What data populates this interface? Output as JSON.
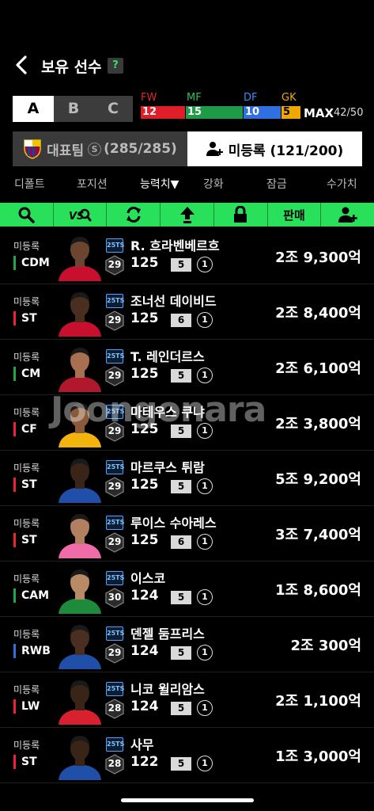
{
  "header": {
    "title": "보유 선수",
    "help_label": "?"
  },
  "abc_tabs": [
    {
      "label": "A",
      "active": true
    },
    {
      "label": "B",
      "active": false
    },
    {
      "label": "C",
      "active": false
    }
  ],
  "position_bars": {
    "items": [
      {
        "label": "FW",
        "count": "12",
        "color": "#e01e2a",
        "label_color": "#e0262f"
      },
      {
        "label": "MF",
        "count": "15",
        "color": "#1f9a46",
        "label_color": "#2fc25a"
      },
      {
        "label": "DF",
        "count": "10",
        "color": "#2f6fe0",
        "label_color": "#3a8cff"
      },
      {
        "label": "GK",
        "count": "5",
        "color": "#f0a800",
        "label_color": "#f0a800"
      }
    ],
    "max_label": "MAX",
    "max_count": "42/50"
  },
  "team_tabs": {
    "national": {
      "label": "대표팀",
      "count": "(285/285)",
      "s_badge": "S"
    },
    "unregistered": {
      "label": "미등록 (121/200)"
    }
  },
  "sort_options": [
    "디폴트",
    "포지션",
    "능력치",
    "강화",
    "잠금",
    "수가치"
  ],
  "sort_active": "능력치",
  "sort_arrow": "▼",
  "toolbar": {
    "sell_label": "판매",
    "icons": [
      "search-icon",
      "vs-compare-icon",
      "swap-icon",
      "upgrade-arrow-icon",
      "lock-icon",
      "sell",
      "add-player-icon"
    ]
  },
  "players": [
    {
      "status": "미등록",
      "position": "CDM",
      "pos_group": "mf",
      "season": "25TS",
      "pay": "29",
      "name": "R. 흐라벤베르흐",
      "ovr": "125",
      "level": "5",
      "enhance": "1",
      "price": "2조 9,300억",
      "kit": "#c8102e",
      "skin": "#6b4530"
    },
    {
      "status": "미등록",
      "position": "ST",
      "pos_group": "fw",
      "season": "25TS",
      "pay": "29",
      "name": "조너선 데이비드",
      "ovr": "125",
      "level": "6",
      "enhance": "1",
      "price": "2조 8,400억",
      "kit": "#c8102e",
      "skin": "#4a2e20"
    },
    {
      "status": "미등록",
      "position": "CM",
      "pos_group": "mf",
      "season": "25TS",
      "pay": "29",
      "name": "T. 레인더르스",
      "ovr": "125",
      "level": "5",
      "enhance": "1",
      "price": "2조 6,100억",
      "kit": "#b2182b",
      "skin": "#a87050"
    },
    {
      "status": "미등록",
      "position": "CF",
      "pos_group": "fw",
      "season": "25TS",
      "pay": "29",
      "name": "마테우스 쿠냐",
      "ovr": "125",
      "level": "5",
      "enhance": "1",
      "price": "2조 3,800억",
      "kit": "#f2b40c",
      "skin": "#8a5a3a"
    },
    {
      "status": "미등록",
      "position": "ST",
      "pos_group": "fw",
      "season": "25TS",
      "pay": "29",
      "name": "마르쿠스 튀람",
      "ovr": "125",
      "level": "5",
      "enhance": "1",
      "price": "5조 9,200억",
      "kit": "#1f4fa8",
      "skin": "#3a2418"
    },
    {
      "status": "미등록",
      "position": "ST",
      "pos_group": "fw",
      "season": "25TS",
      "pay": "29",
      "name": "루이스 수아레스",
      "ovr": "125",
      "level": "6",
      "enhance": "1",
      "price": "3조 7,400억",
      "kit": "#f06ca8",
      "skin": "#b08060"
    },
    {
      "status": "미등록",
      "position": "CAM",
      "pos_group": "mf",
      "season": "25TS",
      "pay": "30",
      "name": "이스코",
      "ovr": "124",
      "level": "5",
      "enhance": "1",
      "price": "1조 8,600억",
      "kit": "#1e8a3c",
      "skin": "#b88a66"
    },
    {
      "status": "미등록",
      "position": "RWB",
      "pos_group": "df",
      "season": "25TS",
      "pay": "29",
      "name": "덴젤 둠프리스",
      "ovr": "124",
      "level": "5",
      "enhance": "1",
      "price": "2조 300억",
      "kit": "#1f4fa8",
      "skin": "#4a2e20"
    },
    {
      "status": "미등록",
      "position": "LW",
      "pos_group": "fw",
      "season": "25TS",
      "pay": "28",
      "name": "니코 윌리암스",
      "ovr": "124",
      "level": "5",
      "enhance": "1",
      "price": "2조 1,100억",
      "kit": "#d8202e",
      "skin": "#3a2418"
    },
    {
      "status": "미등록",
      "position": "ST",
      "pos_group": "fw",
      "season": "25TS",
      "pay": "28",
      "name": "사무",
      "ovr": "122",
      "level": "5",
      "enhance": "1",
      "price": "1조 3,000억",
      "kit": "#1f4fa8",
      "skin": "#3a2418"
    }
  ],
  "watermark": "Joongonara"
}
